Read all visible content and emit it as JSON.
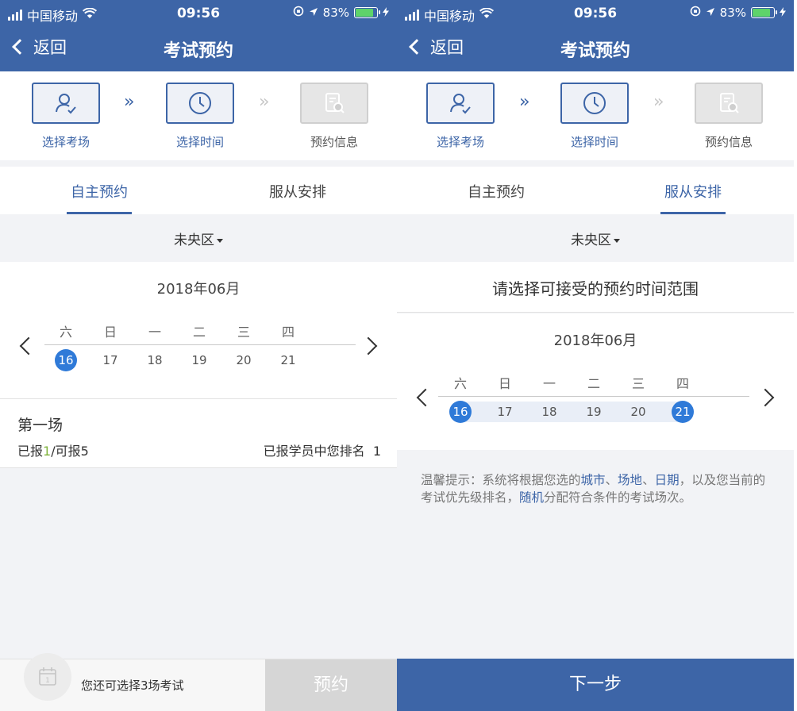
{
  "status": {
    "carrier": "中国移动",
    "time": "09:56",
    "battery": "83%"
  },
  "nav": {
    "back_label": "返回",
    "title": "考试预约"
  },
  "steps": [
    {
      "label": "选择考场",
      "icon": "user-check-icon"
    },
    {
      "label": "选择时间",
      "icon": "clock-icon"
    },
    {
      "label": "预约信息",
      "icon": "document-search-icon"
    }
  ],
  "tabs": [
    "自主预约",
    "服从安排"
  ],
  "district": "未央区",
  "calendar": {
    "month": "2018年06月",
    "weekdays": [
      "六",
      "日",
      "一",
      "二",
      "三",
      "四"
    ],
    "days": [
      "16",
      "17",
      "18",
      "19",
      "20",
      "21"
    ]
  },
  "left": {
    "selected_days": [
      "16"
    ],
    "session": {
      "name": "第一场",
      "registered_prefix": "已报",
      "registered": "1",
      "capacity_label": "/可报5",
      "rank_label": "已报学员中您排名",
      "rank": "1"
    },
    "bottom": {
      "remaining": "您还可选择3场考试",
      "calendar_badge_number": "1",
      "book_label": "预约"
    }
  },
  "right": {
    "range_title": "请选择可接受的预约时间范围",
    "selected_range": [
      "16",
      "21"
    ],
    "tip": {
      "p1": "温馨提示：系统将根据您选的",
      "city": "城市",
      "sep1": "、",
      "venue": "场地",
      "sep2": "、",
      "date": "日期",
      "p2": "，以及您当前的考试优先级排名，",
      "random": "随机",
      "p3": "分配符合条件的考试场次。"
    },
    "next_label": "下一步"
  },
  "colors": {
    "primary": "#3d65a7",
    "selected_day": "#2f7ad8",
    "registered_count": "#7fb33b",
    "disabled_button": "#d6d6d6"
  }
}
